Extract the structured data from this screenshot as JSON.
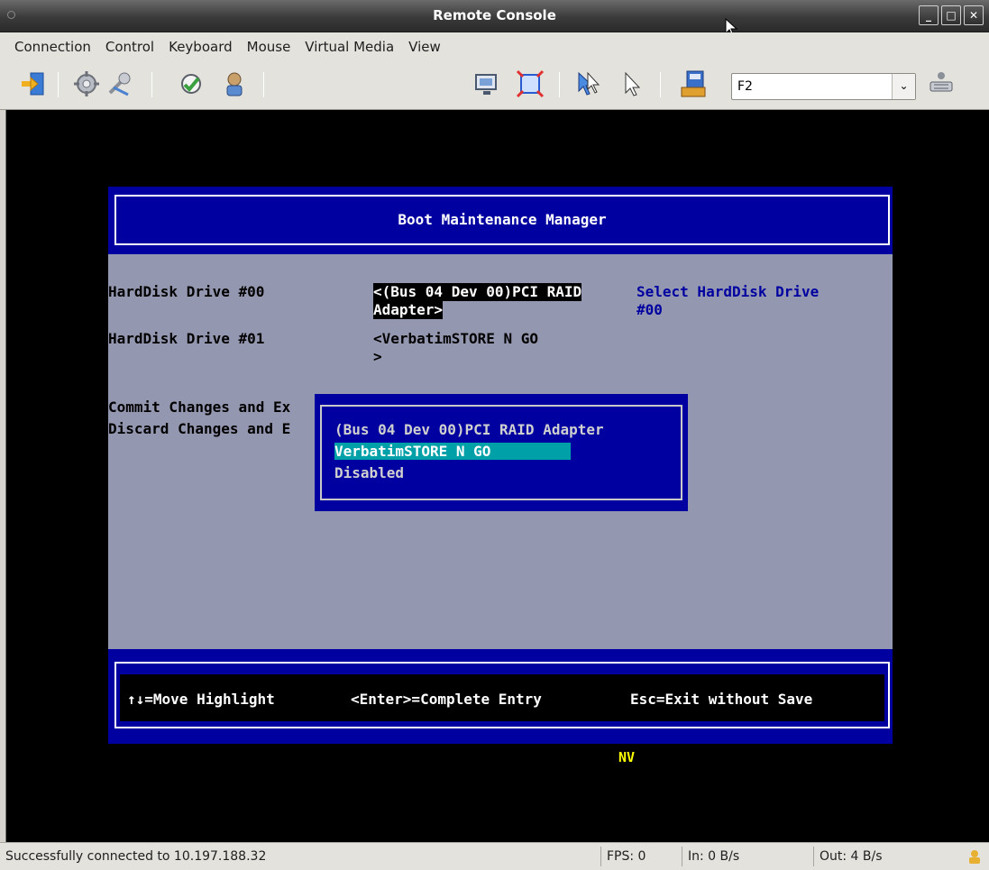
{
  "window": {
    "title": "Remote Console",
    "buttons": [
      "_",
      "□",
      "✕"
    ]
  },
  "menu": [
    "Connection",
    "Control",
    "Keyboard",
    "Mouse",
    "Virtual Media",
    "View"
  ],
  "toolbar": {
    "icons": [
      "exit-icon",
      "settings-icon",
      "tools-icon",
      "sync-icon",
      "user-icon",
      "screenshot-icon",
      "fullscreen-icon",
      "pointer-sync-icon",
      "pointer-icon",
      "keyboard-macro-icon",
      "send-keys-icon"
    ],
    "key_combo": {
      "value": "F2",
      "arrow": "⌄"
    }
  },
  "bios": {
    "title": "Boot Maintenance Manager",
    "items": [
      {
        "label": "HardDisk Drive #00",
        "value_line1": "<(Bus 04 Dev 00)PCI RAID",
        "value_line2": "Adapter>"
      },
      {
        "label": "HardDisk Drive #01",
        "value_line1": "<VerbatimSTORE N GO",
        "value_line2": ">"
      }
    ],
    "actions": [
      "Commit Changes and Ex",
      "Discard Changes and E"
    ],
    "help": {
      "line1": "Select HardDisk Drive",
      "line2": "#00"
    },
    "popup_options": [
      "(Bus 04 Dev 00)PCI RAID Adapter",
      "VerbatimSTORE N GO",
      "Disabled"
    ],
    "popup_selected_index": 1,
    "footer": {
      "move": "↑↓=Move Highlight",
      "enter": "<Enter>=Complete Entry",
      "esc": "Esc=Exit without Save"
    },
    "indicator": "NV"
  },
  "colors": {
    "bios_blue": "#0000a0",
    "bios_gray": "#9497b0",
    "bios_highlight": "#00a0a8",
    "indicator_yellow": "#ffff00"
  },
  "status": {
    "message": "Successfully connected to 10.197.188.32",
    "fps": "FPS: 0",
    "in": "In: 0 B/s",
    "out": "Out: 4 B/s"
  }
}
